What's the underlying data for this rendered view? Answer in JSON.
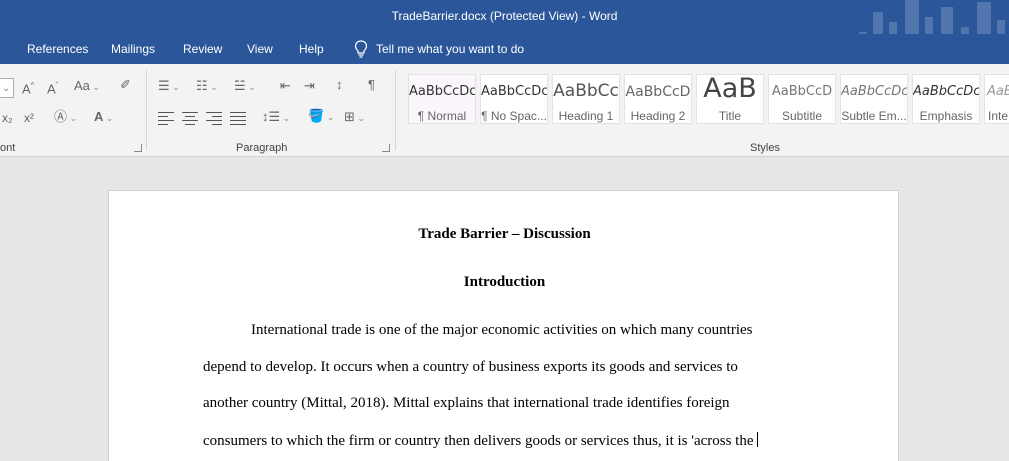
{
  "window": {
    "title": "TradeBarrier.docx (Protected View)  -  Word"
  },
  "ribbon_tabs": [
    "References",
    "Mailings",
    "Review",
    "View",
    "Help"
  ],
  "tell_me": {
    "label": "Tell me what you want to do"
  },
  "groups": {
    "font": "ont",
    "paragraph": "Paragraph",
    "styles": "Styles"
  },
  "styles": [
    {
      "preview": "AaBbCcDc",
      "name": "¶ Normal"
    },
    {
      "preview": "AaBbCcDc",
      "name": "¶ No Spac..."
    },
    {
      "preview": "AaBbCc",
      "name": "Heading 1"
    },
    {
      "preview": "AaBbCcD",
      "name": "Heading 2"
    },
    {
      "preview": "AaB",
      "name": "Title"
    },
    {
      "preview": "AaBbCcD",
      "name": "Subtitle"
    },
    {
      "preview": "AaBbCcDc",
      "name": "Subtle Em..."
    },
    {
      "preview": "AaBbCcDc",
      "name": "Emphasis"
    },
    {
      "preview": "AaBl",
      "name": "Inte"
    }
  ],
  "document": {
    "title": "Trade Barrier – Discussion",
    "section": "Introduction",
    "lines": [
      "International trade is one of the major economic activities on which many countries",
      "depend to develop. It occurs when a country of business exports its goods and services to",
      "another country (Mittal, 2018). Mittal explains that international trade identifies foreign",
      "consumers to which the firm or country then delivers goods or services thus, it is 'across the"
    ]
  },
  "colors": {
    "accent": "#2b579a",
    "ribbon": "#f3f3f3",
    "canvas": "#e6e6e6"
  }
}
